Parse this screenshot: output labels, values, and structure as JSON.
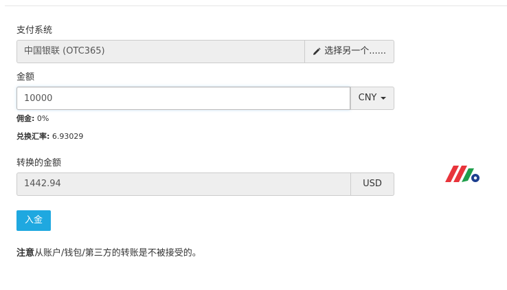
{
  "payment": {
    "label": "支付系统",
    "system_value": "中国银联 (OTC365)",
    "choose_other_label": "选择另一个......"
  },
  "amount": {
    "label": "金额",
    "value": "10000",
    "currency": "CNY"
  },
  "commission": {
    "label": "佣金:",
    "value": "0%"
  },
  "exchange": {
    "label": "兑换汇率:",
    "value": "6.93029"
  },
  "converted": {
    "label": "转换的金额",
    "value": "1442.94",
    "currency": "USD"
  },
  "deposit_button_label": "入金",
  "note": {
    "strong": "注意",
    "text": "从账户/钱包/第三方的转账是不被接受的。"
  },
  "colors": {
    "accent": "#1fa8e0",
    "logo_red": "#e8343b",
    "logo_green": "#1e9e4a",
    "logo_navy": "#1d3f8f"
  },
  "icons": {
    "choose_icon": "pencil-icon",
    "currency_dropdown_icon": "caret-down-icon",
    "brand_icon": "logo-icon"
  }
}
